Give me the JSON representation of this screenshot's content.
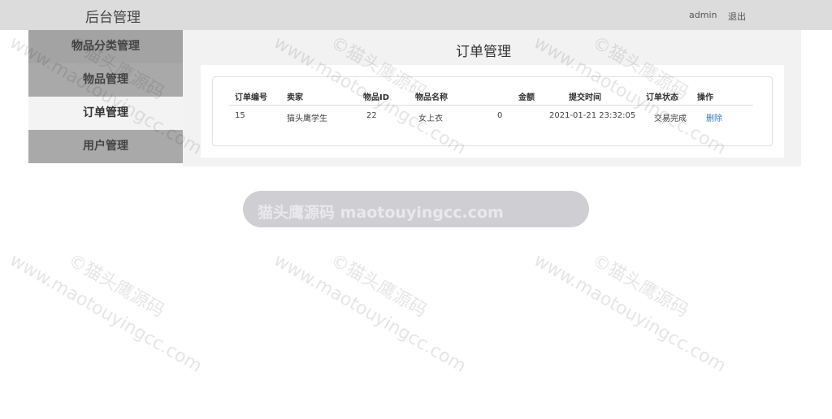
{
  "header": {
    "brand": "后台管理",
    "user": "admin",
    "logout": "退出"
  },
  "sidebar": {
    "items": [
      {
        "label": "物品分类管理"
      },
      {
        "label": "物品管理"
      },
      {
        "label": "订单管理"
      },
      {
        "label": "用户管理"
      }
    ],
    "active_index": 2
  },
  "main": {
    "title": "订单管理",
    "table": {
      "columns": [
        "订单编号",
        "卖家",
        "物品ID",
        "物品名称",
        "金额",
        "提交时间",
        "订单状态",
        "操作"
      ],
      "rows": [
        {
          "order_id": "15",
          "seller": "猫头鹰学生",
          "item_id": "22",
          "item_name": "女上衣",
          "amount": "0",
          "submit_time": "2021-01-21 23:32:05",
          "status": "交易完成",
          "action": "删除"
        }
      ]
    }
  },
  "watermark": {
    "banner": "猫头鹰源码 maotouyingcc.com",
    "diagonal": "www.maotouyingcc.com",
    "copyright": "©猫头鹰源码"
  }
}
